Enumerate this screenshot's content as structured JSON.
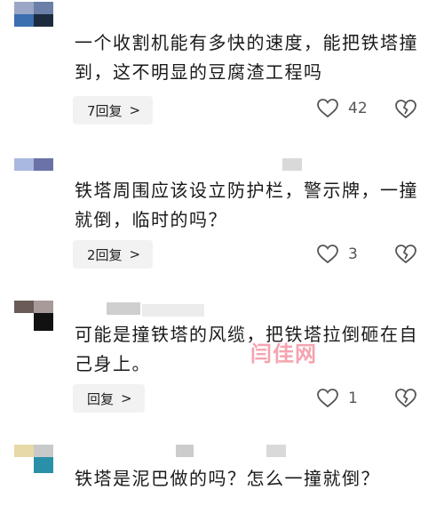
{
  "comments": [
    {
      "text": "一个收割机能有多快的速度，能把铁塔撞到，这不明显的豆腐渣工程吗",
      "reply_label": "7回复",
      "likes": "42",
      "avatar_colors": [
        "#6b7fa8",
        "#9aa7c6",
        "#3a6fb0",
        "#1d2b3f"
      ]
    },
    {
      "text": "铁塔周围应该设立防护栏，警示牌，一撞就倒，临时的吗？",
      "reply_label": "2回复",
      "likes": "3",
      "avatar_colors": [
        "#a9b8df",
        "#6a72a8",
        "#ffffff",
        "#ffffff"
      ]
    },
    {
      "text": "可能是撞铁塔的风缆，把铁塔拉倒砸在自己身上。",
      "reply_label": "回复",
      "likes": "1",
      "avatar_colors": [
        "#6b5b58",
        "#a89a98",
        "#ffffff",
        "#111111"
      ]
    },
    {
      "text": "铁塔是泥巴做的吗？怎么一撞就倒？",
      "avatar_colors": [
        "#e8d9a8",
        "#c9c9c9",
        "#ffffff",
        "#2a90a8"
      ]
    }
  ],
  "icons": {
    "like": "heart-outline-icon",
    "dislike": "broken-heart-icon",
    "chevron": "chevron-right-icon"
  },
  "watermark": "闫佳网"
}
